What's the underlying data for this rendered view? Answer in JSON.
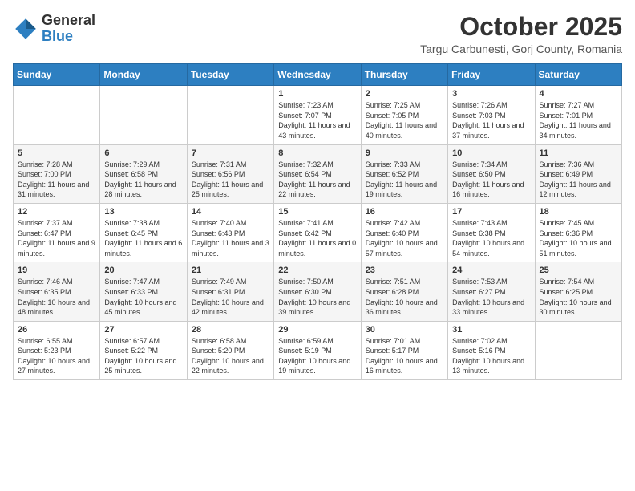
{
  "header": {
    "logo": {
      "general": "General",
      "blue": "Blue"
    },
    "title": "October 2025",
    "location": "Targu Carbunesti, Gorj County, Romania"
  },
  "days_of_week": [
    "Sunday",
    "Monday",
    "Tuesday",
    "Wednesday",
    "Thursday",
    "Friday",
    "Saturday"
  ],
  "weeks": [
    [
      {
        "day": "",
        "info": ""
      },
      {
        "day": "",
        "info": ""
      },
      {
        "day": "",
        "info": ""
      },
      {
        "day": "1",
        "info": "Sunrise: 7:23 AM\nSunset: 7:07 PM\nDaylight: 11 hours and 43 minutes."
      },
      {
        "day": "2",
        "info": "Sunrise: 7:25 AM\nSunset: 7:05 PM\nDaylight: 11 hours and 40 minutes."
      },
      {
        "day": "3",
        "info": "Sunrise: 7:26 AM\nSunset: 7:03 PM\nDaylight: 11 hours and 37 minutes."
      },
      {
        "day": "4",
        "info": "Sunrise: 7:27 AM\nSunset: 7:01 PM\nDaylight: 11 hours and 34 minutes."
      }
    ],
    [
      {
        "day": "5",
        "info": "Sunrise: 7:28 AM\nSunset: 7:00 PM\nDaylight: 11 hours and 31 minutes."
      },
      {
        "day": "6",
        "info": "Sunrise: 7:29 AM\nSunset: 6:58 PM\nDaylight: 11 hours and 28 minutes."
      },
      {
        "day": "7",
        "info": "Sunrise: 7:31 AM\nSunset: 6:56 PM\nDaylight: 11 hours and 25 minutes."
      },
      {
        "day": "8",
        "info": "Sunrise: 7:32 AM\nSunset: 6:54 PM\nDaylight: 11 hours and 22 minutes."
      },
      {
        "day": "9",
        "info": "Sunrise: 7:33 AM\nSunset: 6:52 PM\nDaylight: 11 hours and 19 minutes."
      },
      {
        "day": "10",
        "info": "Sunrise: 7:34 AM\nSunset: 6:50 PM\nDaylight: 11 hours and 16 minutes."
      },
      {
        "day": "11",
        "info": "Sunrise: 7:36 AM\nSunset: 6:49 PM\nDaylight: 11 hours and 12 minutes."
      }
    ],
    [
      {
        "day": "12",
        "info": "Sunrise: 7:37 AM\nSunset: 6:47 PM\nDaylight: 11 hours and 9 minutes."
      },
      {
        "day": "13",
        "info": "Sunrise: 7:38 AM\nSunset: 6:45 PM\nDaylight: 11 hours and 6 minutes."
      },
      {
        "day": "14",
        "info": "Sunrise: 7:40 AM\nSunset: 6:43 PM\nDaylight: 11 hours and 3 minutes."
      },
      {
        "day": "15",
        "info": "Sunrise: 7:41 AM\nSunset: 6:42 PM\nDaylight: 11 hours and 0 minutes."
      },
      {
        "day": "16",
        "info": "Sunrise: 7:42 AM\nSunset: 6:40 PM\nDaylight: 10 hours and 57 minutes."
      },
      {
        "day": "17",
        "info": "Sunrise: 7:43 AM\nSunset: 6:38 PM\nDaylight: 10 hours and 54 minutes."
      },
      {
        "day": "18",
        "info": "Sunrise: 7:45 AM\nSunset: 6:36 PM\nDaylight: 10 hours and 51 minutes."
      }
    ],
    [
      {
        "day": "19",
        "info": "Sunrise: 7:46 AM\nSunset: 6:35 PM\nDaylight: 10 hours and 48 minutes."
      },
      {
        "day": "20",
        "info": "Sunrise: 7:47 AM\nSunset: 6:33 PM\nDaylight: 10 hours and 45 minutes."
      },
      {
        "day": "21",
        "info": "Sunrise: 7:49 AM\nSunset: 6:31 PM\nDaylight: 10 hours and 42 minutes."
      },
      {
        "day": "22",
        "info": "Sunrise: 7:50 AM\nSunset: 6:30 PM\nDaylight: 10 hours and 39 minutes."
      },
      {
        "day": "23",
        "info": "Sunrise: 7:51 AM\nSunset: 6:28 PM\nDaylight: 10 hours and 36 minutes."
      },
      {
        "day": "24",
        "info": "Sunrise: 7:53 AM\nSunset: 6:27 PM\nDaylight: 10 hours and 33 minutes."
      },
      {
        "day": "25",
        "info": "Sunrise: 7:54 AM\nSunset: 6:25 PM\nDaylight: 10 hours and 30 minutes."
      }
    ],
    [
      {
        "day": "26",
        "info": "Sunrise: 6:55 AM\nSunset: 5:23 PM\nDaylight: 10 hours and 27 minutes."
      },
      {
        "day": "27",
        "info": "Sunrise: 6:57 AM\nSunset: 5:22 PM\nDaylight: 10 hours and 25 minutes."
      },
      {
        "day": "28",
        "info": "Sunrise: 6:58 AM\nSunset: 5:20 PM\nDaylight: 10 hours and 22 minutes."
      },
      {
        "day": "29",
        "info": "Sunrise: 6:59 AM\nSunset: 5:19 PM\nDaylight: 10 hours and 19 minutes."
      },
      {
        "day": "30",
        "info": "Sunrise: 7:01 AM\nSunset: 5:17 PM\nDaylight: 10 hours and 16 minutes."
      },
      {
        "day": "31",
        "info": "Sunrise: 7:02 AM\nSunset: 5:16 PM\nDaylight: 10 hours and 13 minutes."
      },
      {
        "day": "",
        "info": ""
      }
    ]
  ]
}
